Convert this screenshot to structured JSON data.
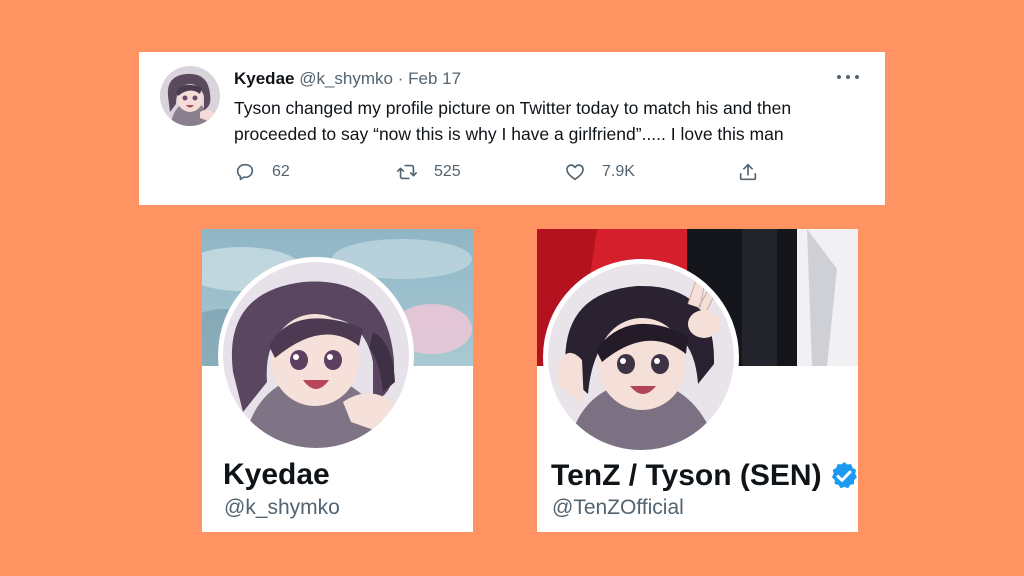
{
  "tweet": {
    "display_name": "Kyedae",
    "handle": "@k_shymko",
    "separator": "·",
    "date": "Feb 17",
    "text": "Tyson changed my profile picture on Twitter today to match his and then proceeded to say “now this is why I have a girlfriend”..... I love this man",
    "stats": {
      "replies": "62",
      "retweets": "525",
      "likes": "7.9K"
    }
  },
  "profiles": {
    "left": {
      "display_name": "Kyedae",
      "handle": "@k_shymko"
    },
    "right": {
      "display_name": "TenZ / Tyson (SEN)",
      "handle": "@TenZOfficial",
      "verified": true
    }
  },
  "colors": {
    "background": "#FF9361",
    "text_primary": "#0f1419",
    "text_secondary": "#536471",
    "verified_blue": "#1D9BF0"
  },
  "icons": {
    "reply": "reply-icon",
    "retweet": "retweet-icon",
    "like": "heart-icon",
    "share": "share-icon",
    "more": "more-icon",
    "verified": "verified-badge-icon"
  }
}
